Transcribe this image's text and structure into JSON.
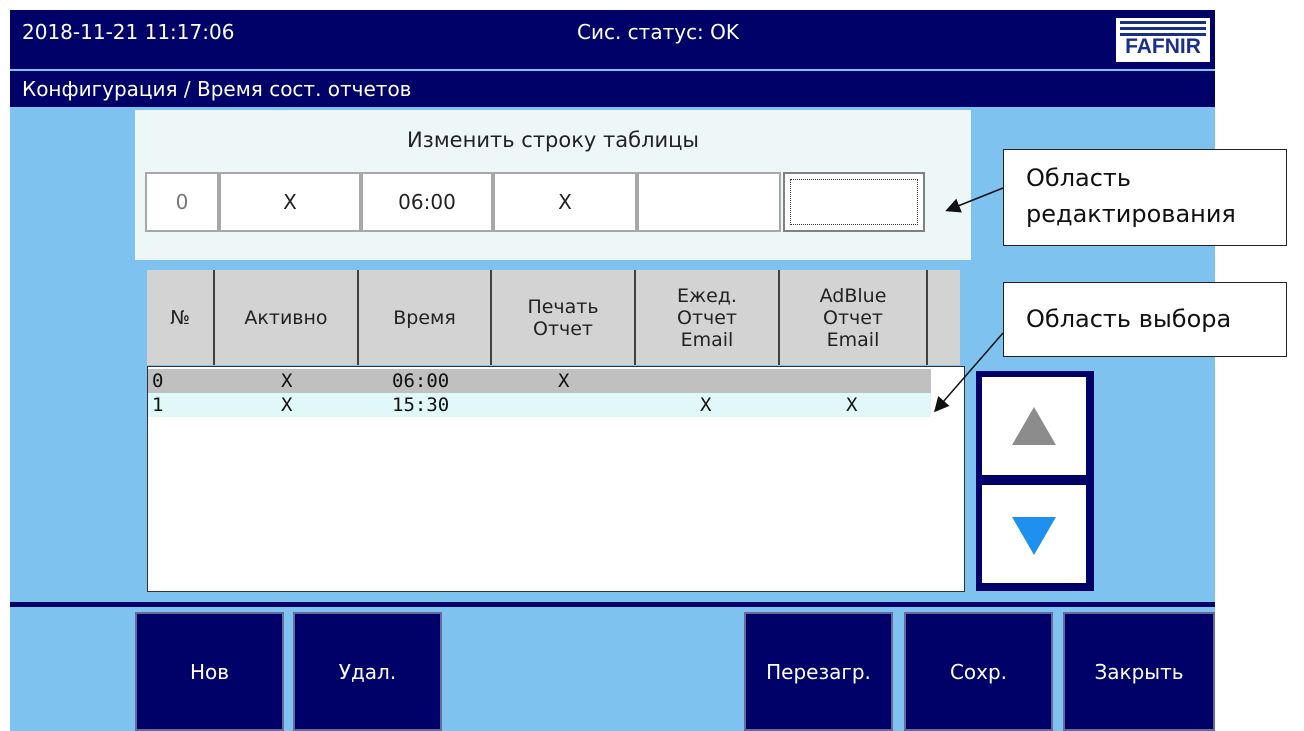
{
  "header": {
    "datetime": "2018-11-21  11:17:06",
    "status": "Сис. статус: OK",
    "logo_text": "FAFNIR"
  },
  "breadcrumb": "Конфигурация / Время сост. отчетов",
  "edit_area": {
    "title": "Изменить строку таблицы",
    "cells": [
      "0",
      "X",
      "06:00",
      "X",
      "",
      ""
    ]
  },
  "table": {
    "headers": [
      "№",
      "Активно",
      "Время",
      "Печать\nОтчет",
      "Ежед.\nОтчет\nEmail",
      "AdBlue\nОтчет\nEmail"
    ],
    "rows": [
      {
        "no": "0",
        "active": "X",
        "time": "06:00",
        "print": "X",
        "daily": "",
        "adblue": ""
      },
      {
        "no": "1",
        "active": "X",
        "time": "15:30",
        "print": "",
        "daily": "X",
        "adblue": "X"
      }
    ]
  },
  "buttons": {
    "new": "Нов",
    "delete": "Удал.",
    "reload": "Перезагр.",
    "save": "Сохр.",
    "close": "Закрыть"
  },
  "callouts": {
    "edit_line1": "Область",
    "edit_line2": "редактирования",
    "select": "Область выбора"
  },
  "colors": {
    "dark_blue": "#000069",
    "screen_bg": "#7ec3f0",
    "selected_row": "#c0c0c0",
    "alt_row": "#e0f8f8",
    "down_arrow": "#1e90f0"
  }
}
